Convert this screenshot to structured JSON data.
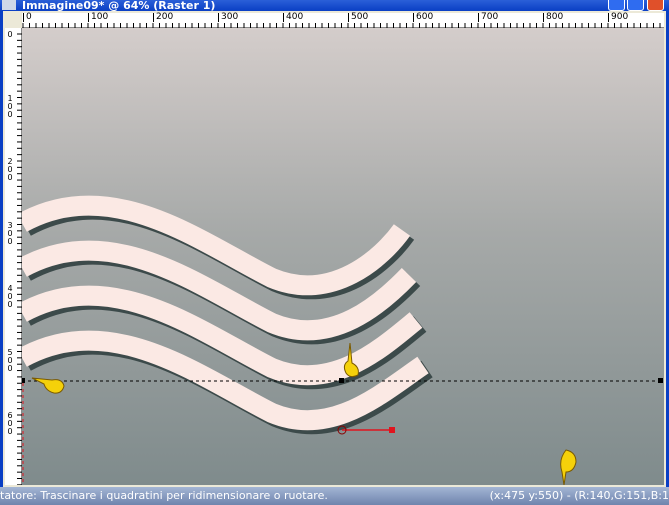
{
  "window": {
    "title": "Immagine09* @ 64% (Raster 1)"
  },
  "rulers": {
    "horizontal": [
      "0",
      "100",
      "200",
      "300",
      "400",
      "500",
      "600",
      "700",
      "800",
      "900"
    ],
    "vertical": [
      "0",
      "100",
      "200",
      "300",
      "400",
      "500",
      "600"
    ]
  },
  "status": {
    "hint": "tatore: Trascinare i quadratini per ridimensionare o ruotare.",
    "readout": "(x:475 y:550) - (R:140,G:151,B:1"
  },
  "colors": {
    "wave": "#fbe9e4",
    "wave_shadow": "#3c4a4a",
    "guide": "#000000",
    "handle": "#e0141e"
  }
}
